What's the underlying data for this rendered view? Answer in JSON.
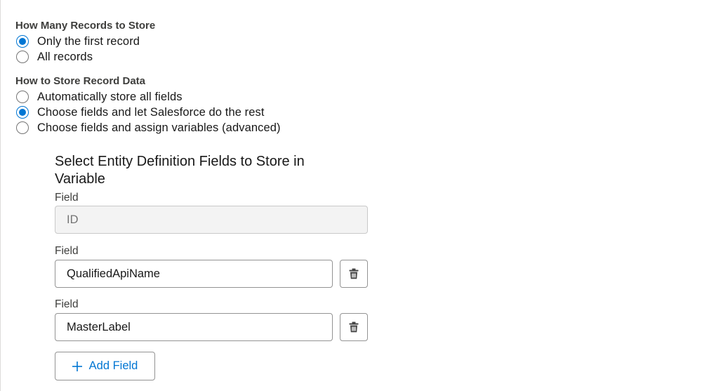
{
  "records_section": {
    "label": "How Many Records to Store",
    "options": [
      {
        "label": "Only the first record",
        "checked": true
      },
      {
        "label": "All records",
        "checked": false
      }
    ]
  },
  "storage_section": {
    "label": "How to Store Record Data",
    "options": [
      {
        "label": "Automatically store all fields",
        "checked": false
      },
      {
        "label": "Choose fields and let Salesforce do the rest",
        "checked": true
      },
      {
        "label": "Choose fields and assign variables (advanced)",
        "checked": false
      }
    ]
  },
  "entity_fields": {
    "title": "Select Entity Definition Fields to Store in Variable",
    "fields": [
      {
        "label": "Field",
        "value": "ID",
        "disabled": true
      },
      {
        "label": "Field",
        "value": "QualifiedApiName",
        "disabled": false
      },
      {
        "label": "Field",
        "value": "MasterLabel",
        "disabled": false
      }
    ],
    "add_button_label": "Add Field"
  },
  "colors": {
    "accent": "#0176d3",
    "border": "#939393",
    "disabled_bg": "#f3f3f3"
  },
  "icons": {
    "delete": "trash-icon",
    "add": "plus-icon"
  }
}
